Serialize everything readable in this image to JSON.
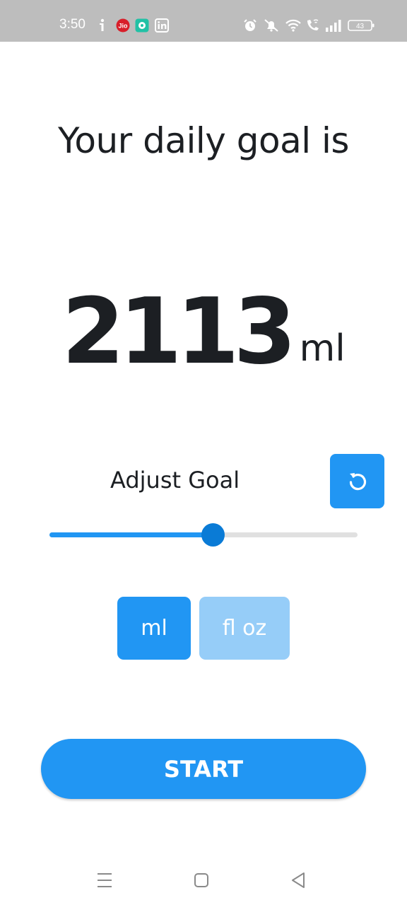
{
  "status_bar": {
    "time": "3:50",
    "battery": "43",
    "icons": [
      "info-icon",
      "jio-icon",
      "chat-app-icon",
      "linkedin-icon",
      "alarm-icon",
      "mute-icon",
      "wifi-icon",
      "wifi-call-icon",
      "signal-icon",
      "battery-icon"
    ]
  },
  "main": {
    "title": "Your daily goal is",
    "goal_value": "2113",
    "goal_unit": "ml",
    "adjust_label": "Adjust Goal",
    "reset_icon": "reset-icon",
    "slider_fraction": 0.53
  },
  "unit_toggle": {
    "ml_label": "ml",
    "floz_label": "fl oz",
    "selected": "ml"
  },
  "start_label": "START",
  "colors": {
    "accent": "#2196f3",
    "accent_light": "#96cdf8",
    "thumb": "#0a7bd6",
    "text": "#1c1f23",
    "status_bar": "#bdbdbd"
  },
  "nav_bar": {
    "icons": [
      "menu-icon",
      "home-icon",
      "back-icon"
    ]
  }
}
